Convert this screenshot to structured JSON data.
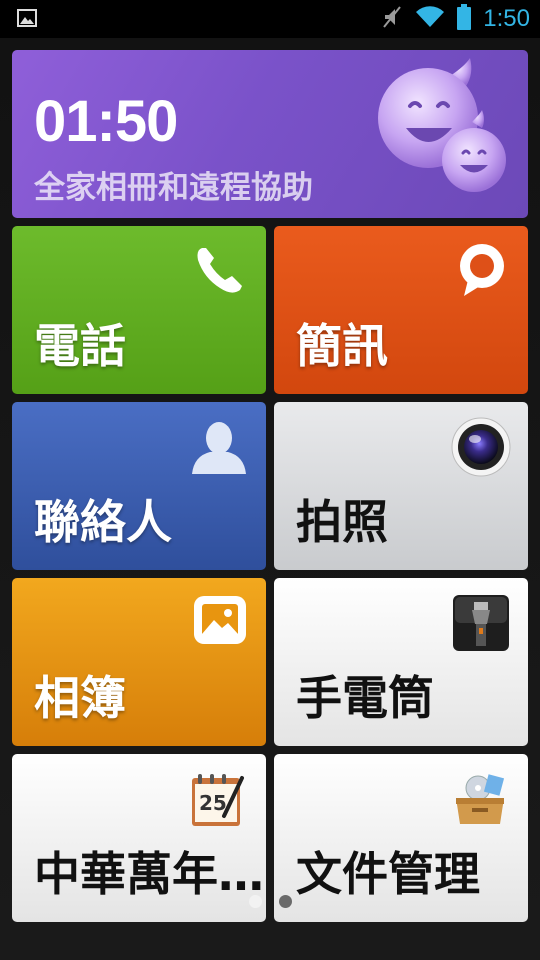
{
  "statusbar": {
    "time": "1:50",
    "icons": [
      "gallery-notification-icon",
      "mute-icon",
      "wifi-icon",
      "battery-icon"
    ],
    "accent": "#33b5e5"
  },
  "banner": {
    "clock": "01:50",
    "subtitle": "全家相冊和遠程協助",
    "icon": "smiley-mascot-icon"
  },
  "tiles": [
    {
      "label": "電話",
      "icon": "phone-icon",
      "color": "#5fae22"
    },
    {
      "label": "簡訊",
      "icon": "message-bubble-icon",
      "color": "#e0531a"
    },
    {
      "label": "聯絡人",
      "icon": "contact-person-icon",
      "color": "#3d5fb2"
    },
    {
      "label": "拍照",
      "icon": "camera-lens-icon",
      "color": "#d9dadc"
    },
    {
      "label": "相簿",
      "icon": "picture-icon",
      "color": "#e69612"
    },
    {
      "label": "手電筒",
      "icon": "flashlight-icon",
      "color": "#f2f2f2"
    },
    {
      "label": "中華萬年…",
      "icon": "calendar-icon",
      "color": "#f2f2f2"
    },
    {
      "label": "文件管理",
      "icon": "file-box-icon",
      "color": "#f2f2f2"
    }
  ],
  "calendar_icon_day": "25",
  "pager": {
    "pages": 2,
    "current": 1
  }
}
